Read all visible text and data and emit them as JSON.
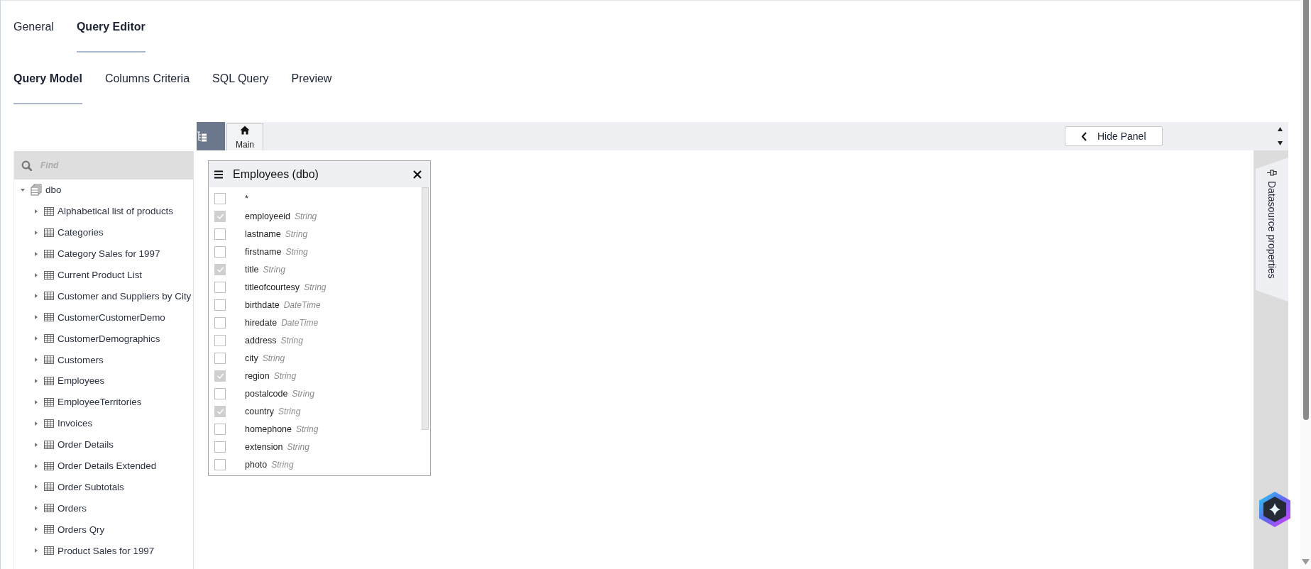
{
  "tabs": [
    {
      "label": "General",
      "selected": false
    },
    {
      "label": "Query Editor",
      "selected": true
    }
  ],
  "subtabs": [
    {
      "label": "Query Model",
      "selected": true
    },
    {
      "label": "Columns Criteria",
      "selected": false
    },
    {
      "label": "SQL Query",
      "selected": false
    },
    {
      "label": "Preview",
      "selected": false
    }
  ],
  "tree": {
    "search": {
      "placeholder": "Find"
    },
    "items": [
      {
        "label": "dbo",
        "kind": "schema",
        "expanded": true,
        "children": [
          {
            "label": "Alphabetical list of products",
            "kind": "table",
            "expanded": false
          },
          {
            "label": "Categories",
            "kind": "table",
            "expanded": false
          },
          {
            "label": "Category Sales for 1997",
            "kind": "table",
            "expanded": false
          },
          {
            "label": "Current Product List",
            "kind": "table",
            "expanded": false
          },
          {
            "label": "Customer and Suppliers by City",
            "kind": "table",
            "expanded": false
          },
          {
            "label": "CustomerCustomerDemo",
            "kind": "table",
            "expanded": false
          },
          {
            "label": "CustomerDemographics",
            "kind": "table",
            "expanded": false
          },
          {
            "label": "Customers",
            "kind": "table",
            "expanded": false
          },
          {
            "label": "Employees",
            "kind": "table",
            "expanded": false
          },
          {
            "label": "EmployeeTerritories",
            "kind": "table",
            "expanded": false
          },
          {
            "label": "Invoices",
            "kind": "table",
            "expanded": false
          },
          {
            "label": "Order Details",
            "kind": "table",
            "expanded": false
          },
          {
            "label": "Order Details Extended",
            "kind": "table",
            "expanded": false
          },
          {
            "label": "Order Subtotals",
            "kind": "table",
            "expanded": false
          },
          {
            "label": "Orders",
            "kind": "table",
            "expanded": false
          },
          {
            "label": "Orders Qry",
            "kind": "table",
            "expanded": false
          },
          {
            "label": "Product Sales for 1997",
            "kind": "table",
            "expanded": false
          }
        ]
      }
    ]
  },
  "toolbar": {
    "home": {
      "label": "Main"
    },
    "hide_panel": {
      "label": "Hide Panel"
    }
  },
  "table_box": {
    "title": "Employees (dbo)",
    "fields": [
      {
        "name": "*",
        "checked": false
      },
      {
        "name": "employeeid",
        "type": "String",
        "checked": true
      },
      {
        "name": "lastname",
        "type": "String",
        "checked": false
      },
      {
        "name": "firstname",
        "type": "String",
        "checked": false
      },
      {
        "name": "title",
        "type": "String",
        "checked": true
      },
      {
        "name": "titleofcourtesy",
        "type": "String",
        "checked": false
      },
      {
        "name": "birthdate",
        "type": "DateTime",
        "checked": false
      },
      {
        "name": "hiredate",
        "type": "DateTime",
        "checked": false
      },
      {
        "name": "address",
        "type": "String",
        "checked": false
      },
      {
        "name": "city",
        "type": "String",
        "checked": false
      },
      {
        "name": "region",
        "type": "String",
        "checked": true
      },
      {
        "name": "postalcode",
        "type": "String",
        "checked": false
      },
      {
        "name": "country",
        "type": "String",
        "checked": true
      },
      {
        "name": "homephone",
        "type": "String",
        "checked": false
      },
      {
        "name": "extension",
        "type": "String",
        "checked": false
      },
      {
        "name": "photo",
        "type": "String",
        "checked": false
      }
    ]
  },
  "side_tab": {
    "label": "Datasource properties"
  }
}
